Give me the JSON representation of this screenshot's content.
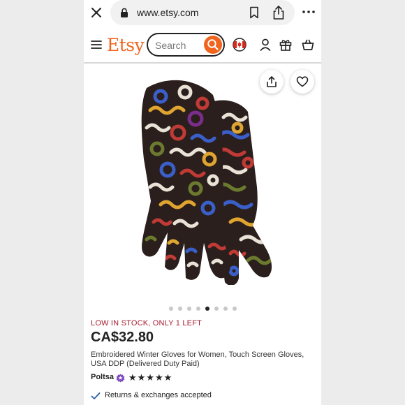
{
  "browser": {
    "url": "www.etsy.com"
  },
  "header": {
    "logo": "Etsy",
    "search_placeholder": "Search",
    "brand_color": "#f1641e"
  },
  "icons": {
    "close": "close-icon",
    "lock": "lock-icon",
    "bookmark": "bookmark-icon",
    "share": "share-icon",
    "more": "more-icon",
    "menu": "menu-icon",
    "search": "search-icon",
    "flag": "canada-flag-icon",
    "account": "account-icon",
    "gift": "gift-icon",
    "cart": "cart-icon",
    "favorite": "heart-icon",
    "star_seller": "star-seller-icon",
    "check": "check-icon"
  },
  "carousel": {
    "total_images": 8,
    "active_index": 4
  },
  "product": {
    "stock_notice": "LOW IN STOCK, ONLY 1 LEFT",
    "price": "CA$32.80",
    "title": "Embroidered Winter Gloves for Women, Touch Screen Gloves, USA DDP (Delivered Duty Paid)",
    "shop_name": "Poltsa",
    "rating_stars": "★★★★★",
    "rating": 5,
    "returns_text": "Returns & exchanges accepted"
  },
  "colors": {
    "stock_red": "#a61a2e",
    "check_blue": "#2f5fa8",
    "star_seller_purple": "#7f4dbe"
  }
}
